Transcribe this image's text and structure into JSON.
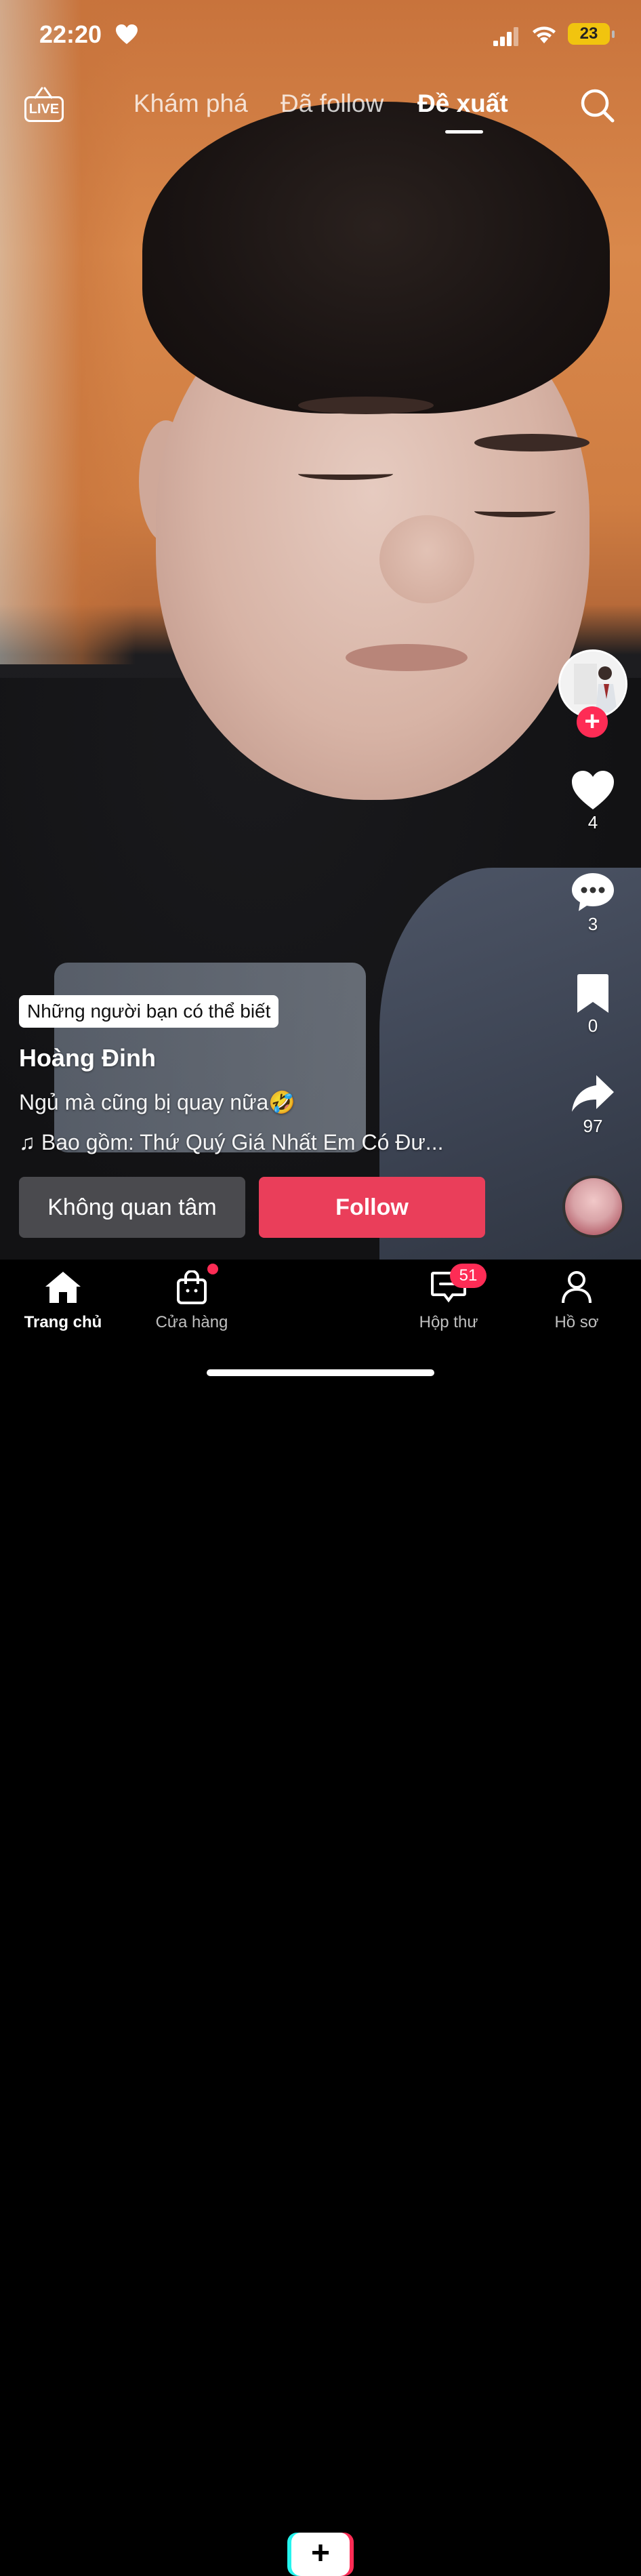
{
  "status_bar": {
    "time": "22:20",
    "battery": "23",
    "icons": [
      "heart-icon",
      "signal-icon",
      "wifi-icon",
      "battery-icon"
    ]
  },
  "top_nav": {
    "live_label": "LIVE",
    "tabs": [
      {
        "label": "Khám phá",
        "active": false
      },
      {
        "label": "Đã follow",
        "active": false
      },
      {
        "label": "Đề xuất",
        "active": true
      }
    ]
  },
  "video": {
    "suggestion_chip": "Những người bạn có thể biết",
    "username": "Hoàng Đinh",
    "caption": "Ngủ mà cũng bị quay nữa🤣",
    "music": "♫ Bao gồm: Thứ Quý Giá Nhất Em Có Đư..."
  },
  "actions": {
    "likes": "4",
    "comments": "3",
    "saves": "0",
    "shares": "97"
  },
  "buttons": {
    "not_interested": "Không quan tâm",
    "follow": "Follow"
  },
  "bottom_tabs": {
    "home": "Trang chủ",
    "shop": "Cửa hàng",
    "inbox": "Hộp thư",
    "inbox_badge": "51",
    "profile": "Hồ sơ"
  },
  "colors": {
    "accent": "#fe2c55",
    "follow_button": "#ea3e5a",
    "cyan": "#25f4ee",
    "battery": "#f1c40f"
  }
}
